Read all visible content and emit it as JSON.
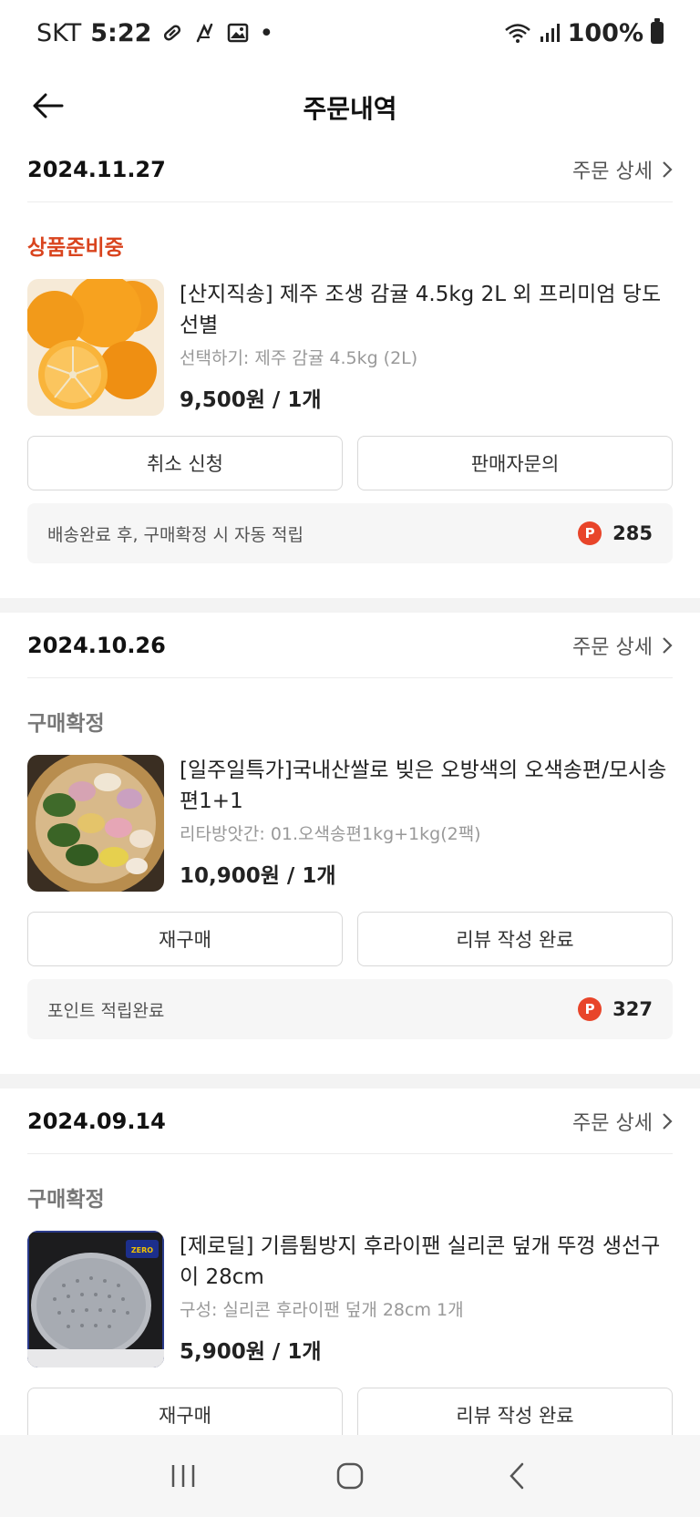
{
  "status_bar": {
    "carrier": "SKT",
    "time": "5:22",
    "dot": "•",
    "battery": "100%",
    "icons": [
      "pill-icon",
      "gesture-icon",
      "image-icon",
      "wifi-icon",
      "signal-icon",
      "battery-icon"
    ]
  },
  "header": {
    "title": "주문내역",
    "back_icon": "arrow-left-icon"
  },
  "orders": [
    {
      "date": "2024.11.27",
      "detail_label": "주문 상세",
      "status": "상품준비중",
      "status_color": "#d9441e",
      "product_name": "[산지직송] 제주 조생 감귤 4.5kg 2L 외 프리미엄 당도 선별",
      "option": "선택하기: 제주 감귤 4.5kg (2L)",
      "price": "9,500원 / 1개",
      "buttons": [
        "취소 신청",
        "판매자문의"
      ],
      "points_text": "배송완료 후, 구매확정 시 자동 적립",
      "points_badge": "P",
      "points_value": "285"
    },
    {
      "date": "2024.10.26",
      "detail_label": "주문 상세",
      "status": "구매확정",
      "status_color": "#777777",
      "product_name": "[일주일특가]국내산쌀로 빚은 오방색의 오색송편/모시송편1+1",
      "option": "리타방앗간: 01.오색송편1kg+1kg(2팩)",
      "price": "10,900원 / 1개",
      "buttons": [
        "재구매",
        "리뷰 작성 완료"
      ],
      "points_text": "포인트 적립완료",
      "points_badge": "P",
      "points_value": "327"
    },
    {
      "date": "2024.09.14",
      "detail_label": "주문 상세",
      "status": "구매확정",
      "status_color": "#777777",
      "product_name": "[제로딜] 기름튐방지 후라이팬 실리콘 덮개 뚜껑 생선구이 28cm",
      "option": "구성: 실리콘 후라이팬 덮개 28cm 1개",
      "price": "5,900원 / 1개",
      "thumb_badge": "ZERO",
      "buttons": [
        "재구매",
        "리뷰 작성 완료"
      ]
    }
  ],
  "nav_bar": {
    "icons": [
      "recent-apps-icon",
      "home-icon",
      "back-icon"
    ]
  },
  "colors": {
    "accent": "#d9441e",
    "points_badge": "#e8452a"
  }
}
